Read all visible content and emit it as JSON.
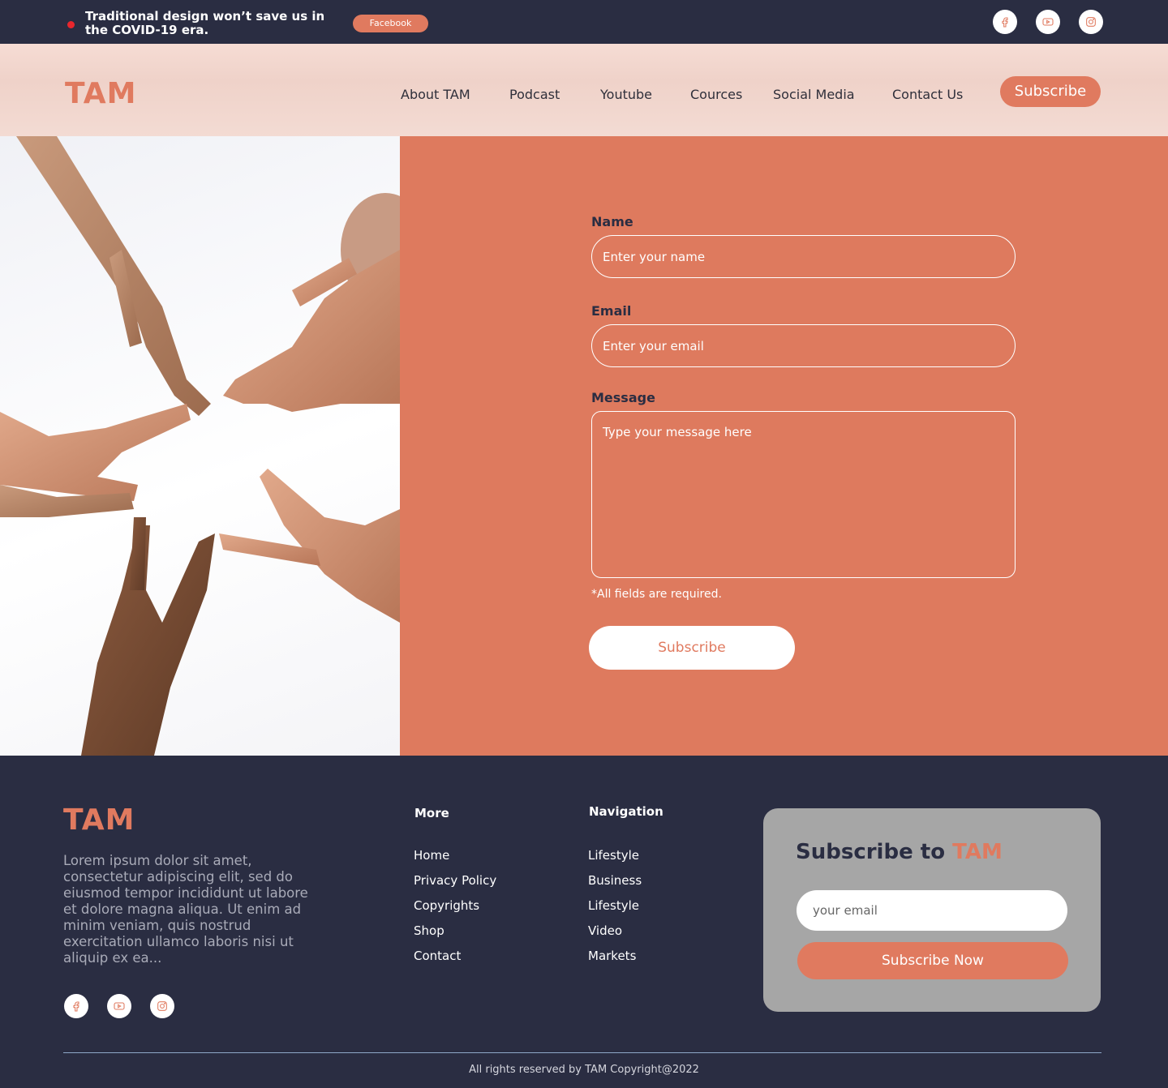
{
  "topbar": {
    "headline": "Traditional design won’t save us in the COVID-19 era.",
    "pill": "Facebook",
    "icons": [
      "facebook-icon",
      "youtube-icon",
      "instagram-icon"
    ]
  },
  "header": {
    "logo": "TAM",
    "nav": [
      "About  TAM",
      "Podcast",
      "Youtube",
      "Cources",
      "Social Media",
      "Contact Us"
    ],
    "subscribe": "Subscribe"
  },
  "form": {
    "name_label": "Name",
    "name_placeholder": "Enter your name",
    "email_label": "Email",
    "email_placeholder": "Enter your email",
    "message_label": "Message",
    "message_placeholder": "Type your message here",
    "required_note": "*All fields are required.",
    "submit": "Subscribe"
  },
  "footer": {
    "logo": "TAM",
    "about": "Lorem ipsum dolor sit amet, consectetur adipiscing elit, sed do eiusmod tempor incididunt ut labore et dolore magna aliqua. Ut enim ad minim veniam, quis nostrud exercitation ullamco laboris nisi ut aliquip ex ea...",
    "more_title": "More",
    "more_links": [
      "Home",
      "Privacy Policy",
      "Copyrights",
      "Shop",
      "Contact"
    ],
    "nav_title": "Navigation",
    "nav_links": [
      "Lifestyle",
      "Business",
      "Lifestyle",
      "Video",
      "Markets"
    ],
    "subscribe_title": "Subscribe to ",
    "subscribe_brand": "TAM",
    "email_placeholder": "your email",
    "subscribe_button": "Subscribe Now",
    "copyright": "All rights reserved by TAM Copyright@2022"
  },
  "colors": {
    "accent": "#e07a5f",
    "dark": "#2a2d42",
    "form_bg": "#de7a5e",
    "card_bg": "#a6a6a6"
  }
}
